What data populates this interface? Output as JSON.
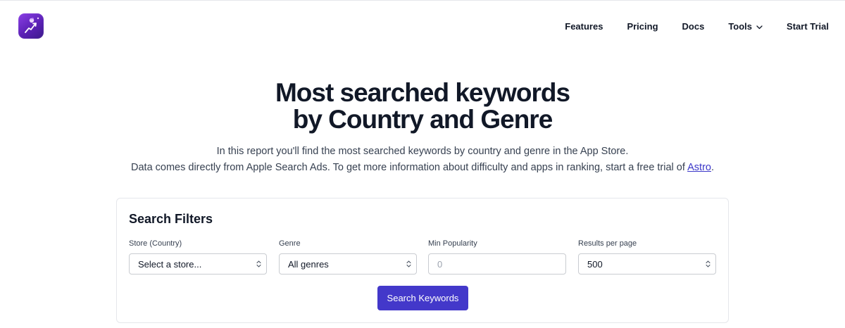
{
  "nav": {
    "features": "Features",
    "pricing": "Pricing",
    "docs": "Docs",
    "tools": "Tools",
    "start_trial": "Start Trial"
  },
  "hero": {
    "title_line1": "Most searched keywords",
    "title_line2": "by Country and Genre",
    "desc_line1": "In this report you'll find the most searched keywords by country and genre in the App Store.",
    "desc_line2_prefix": "Data comes directly from Apple Search Ads. To get more information about difficulty and apps in ranking, start a free trial of ",
    "desc_link": "Astro",
    "desc_line2_suffix": "."
  },
  "filters": {
    "title": "Search Filters",
    "store": {
      "label": "Store (Country)",
      "value": "Select a store..."
    },
    "genre": {
      "label": "Genre",
      "value": "All genres"
    },
    "min_popularity": {
      "label": "Min Popularity",
      "placeholder": "0"
    },
    "results_per_page": {
      "label": "Results per page",
      "value": "500"
    },
    "search_button": "Search Keywords"
  },
  "colors": {
    "accent": "#4338ca",
    "link": "#3b37c9",
    "logo_gradient": [
      "#8b3fe6",
      "#3b1a8a"
    ]
  },
  "icons": {
    "logo": "astro-app-logo-icon",
    "tools_chevron": "chevron-down-icon",
    "select_arrows": "updown-chevron-icon"
  }
}
